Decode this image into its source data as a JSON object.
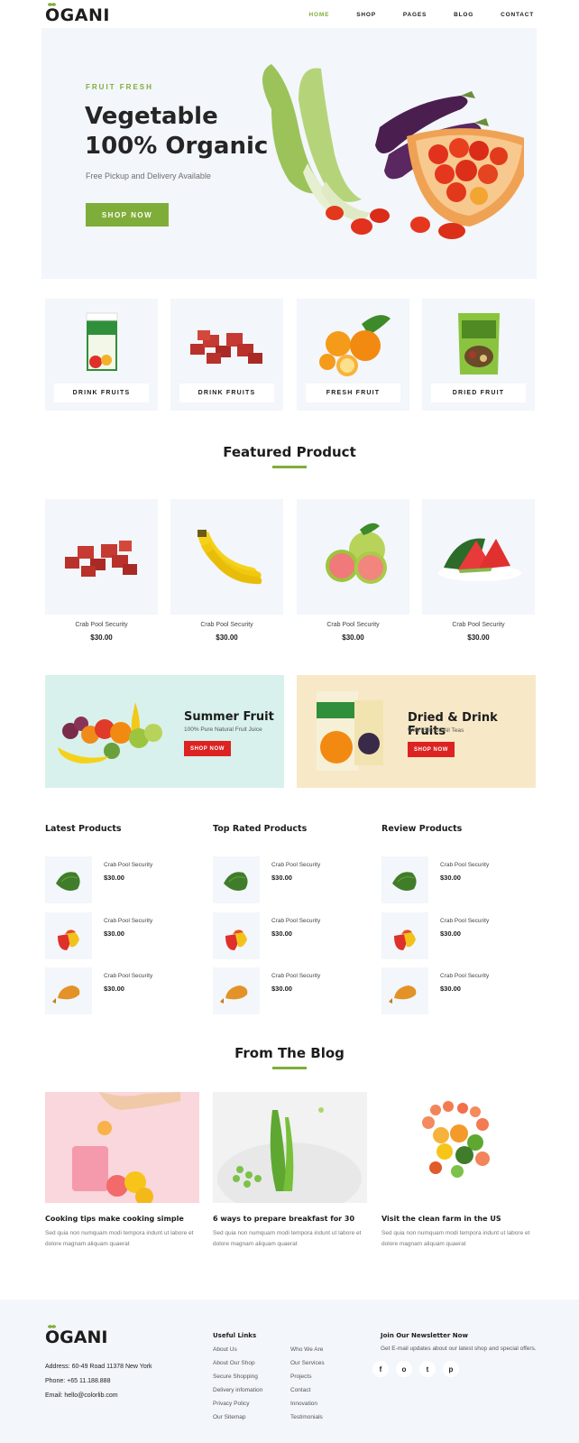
{
  "header": {
    "logo": "OGANI",
    "nav": [
      "HOME",
      "SHOP",
      "PAGES",
      "BLOG",
      "CONTACT"
    ]
  },
  "hero": {
    "kicker": "FRUIT FRESH",
    "title_line1": "Vegetable",
    "title_line2": "100% Organic",
    "subtitle": "Free Pickup and Delivery Available",
    "cta": "SHOP NOW"
  },
  "categories": [
    "DRINK FRUITS",
    "DRINK FRUITS",
    "FRESH FRUIT",
    "DRIED FRUIT"
  ],
  "featured": {
    "title": "Featured Product",
    "items": [
      {
        "name": "Crab Pool Security",
        "price": "$30.00"
      },
      {
        "name": "Crab Pool Security",
        "price": "$30.00"
      },
      {
        "name": "Crab Pool Security",
        "price": "$30.00"
      },
      {
        "name": "Crab Pool Security",
        "price": "$30.00"
      }
    ]
  },
  "banners": [
    {
      "title": "Summer Fruit",
      "subtitle": "100% Pure Natural Fruit Juice",
      "cta": "SHOP NOW"
    },
    {
      "title": "Dried & Drink Fruits",
      "subtitle": "With 25% Off All Teas",
      "cta": "SHOP NOW"
    }
  ],
  "lists": [
    {
      "title": "Latest Products",
      "items": [
        {
          "name": "Crab Pool Security",
          "price": "$30.00"
        },
        {
          "name": "Crab Pool Security",
          "price": "$30.00"
        },
        {
          "name": "Crab Pool Security",
          "price": "$30.00"
        }
      ]
    },
    {
      "title": "Top Rated Products",
      "items": [
        {
          "name": "Crab Pool Security",
          "price": "$30.00"
        },
        {
          "name": "Crab Pool Security",
          "price": "$30.00"
        },
        {
          "name": "Crab Pool Security",
          "price": "$30.00"
        }
      ]
    },
    {
      "title": "Review Products",
      "items": [
        {
          "name": "Crab Pool Security",
          "price": "$30.00"
        },
        {
          "name": "Crab Pool Security",
          "price": "$30.00"
        },
        {
          "name": "Crab Pool Security",
          "price": "$30.00"
        }
      ]
    }
  ],
  "blog": {
    "title": "From The Blog",
    "posts": [
      {
        "title": "Cooking tips make cooking simple",
        "excerpt": "Sed quia non numquam modi tempora indunt ut labore et dolore magnam aliquam quaerat"
      },
      {
        "title": "6 ways to prepare breakfast for 30",
        "excerpt": "Sed quia non numquam modi tempora indunt ut labore et dolore magnam aliquam quaerat"
      },
      {
        "title": "Visit the clean farm in the US",
        "excerpt": "Sed quia non numquam modi tempora indunt ut labore et dolore magnam aliquam quaerat"
      }
    ]
  },
  "footer": {
    "logo": "OGANI",
    "address": "Address: 60-49 Road 11378 New York",
    "phone": "Phone: +65 11.188.888",
    "email": "Email: hello@colorlib.com",
    "useful_links_title": "Useful Links",
    "links_col1": [
      "About Us",
      "About Our Shop",
      "Secure Shopping",
      "Delivery infomation",
      "Privacy Policy",
      "Our Sitemap"
    ],
    "links_col2": [
      "Who We Are",
      "Our Services",
      "Projects",
      "Contact",
      "Innovation",
      "Testimonials"
    ],
    "newsletter_title": "Join Our Newsletter Now",
    "newsletter_text": "Get E-mail updates about our latest shop and special offers.",
    "social": [
      "f",
      "o",
      "t",
      "p"
    ]
  },
  "colors": {
    "accent": "#7fad39",
    "sale": "#dd2222",
    "panel": "#f3f6fa"
  }
}
